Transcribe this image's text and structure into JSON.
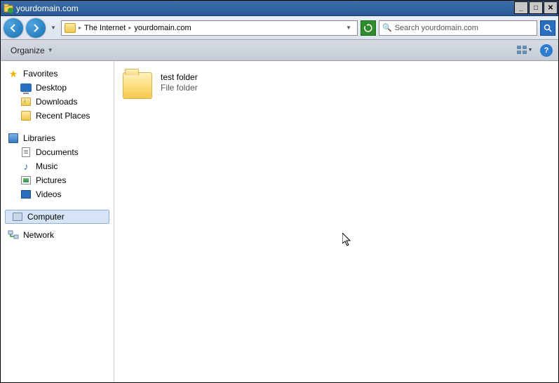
{
  "window": {
    "title": "yourdomain.com"
  },
  "nav": {
    "breadcrumb": {
      "root": "The Internet",
      "current": "yourdomain.com"
    },
    "search_placeholder": "Search yourdomain.com"
  },
  "cmdbar": {
    "organize": "Organize"
  },
  "sidebar": {
    "favorites": {
      "label": "Favorites",
      "items": [
        "Desktop",
        "Downloads",
        "Recent Places"
      ]
    },
    "libraries": {
      "label": "Libraries",
      "items": [
        "Documents",
        "Music",
        "Pictures",
        "Videos"
      ]
    },
    "computer": {
      "label": "Computer"
    },
    "network": {
      "label": "Network"
    }
  },
  "content": {
    "items": [
      {
        "name": "test folder",
        "type": "File folder"
      }
    ]
  }
}
